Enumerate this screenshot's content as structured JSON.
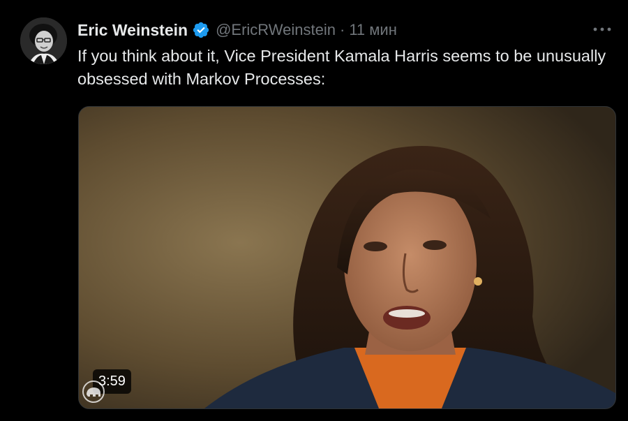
{
  "tweet": {
    "author": {
      "display_name": "Eric Weinstein",
      "handle": "@EricRWeinstein",
      "verified": true,
      "avatar_icon": "author-avatar"
    },
    "separator": "·",
    "time": "11 мин",
    "more_icon": "more-horizontal-icon",
    "text": "If you think about it, Vice President Kamala Harris seems to be unusually obsessed with Markov Processes:",
    "media": {
      "type": "video",
      "duration": "3:59",
      "watermark_icon": "republican-elephant-logo"
    }
  },
  "colors": {
    "background": "#000000",
    "primary_text": "#e7e9ea",
    "secondary_text": "#71767b",
    "verified_blue": "#1d9bf0",
    "border": "#2f3336"
  }
}
